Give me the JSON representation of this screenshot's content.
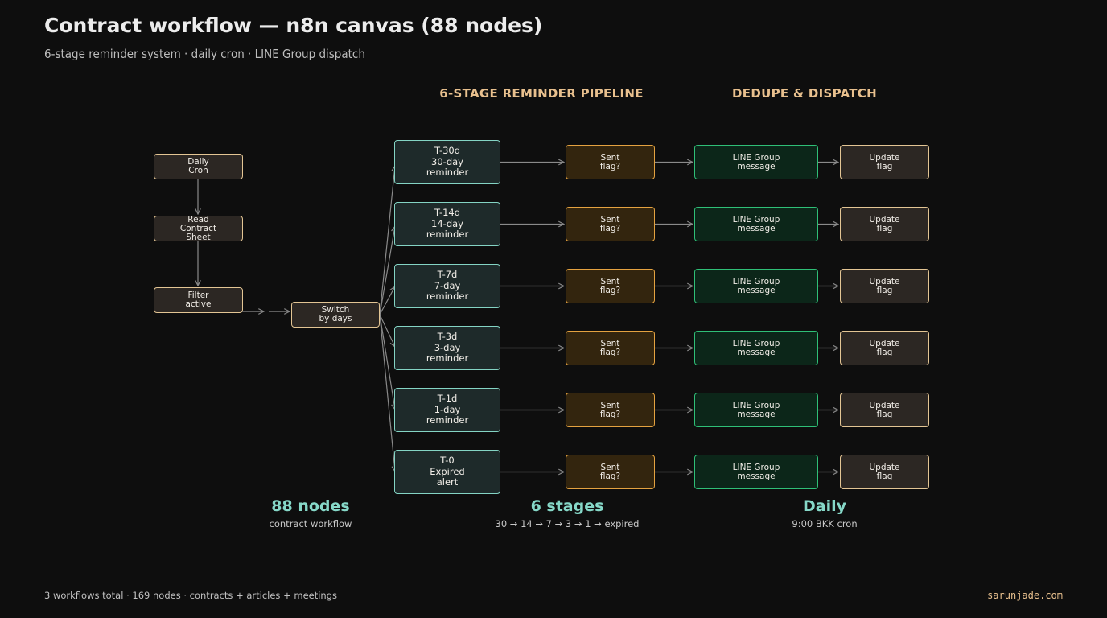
{
  "header": {
    "title": "Contract workflow — n8n canvas (88 nodes)",
    "subtitle": "6-stage reminder system · daily cron · LINE Group dispatch"
  },
  "sections": {
    "pipeline": "6-STAGE REMINDER PIPELINE",
    "dispatch": "DEDUPE & DISPATCH"
  },
  "trigger_nodes": [
    {
      "label": "Daily\nCron",
      "icon": "clock-icon"
    },
    {
      "label": "Read\nContract\nSheet",
      "icon": "sheet-icon"
    },
    {
      "label": "Filter\nactive",
      "icon": "filter-icon"
    }
  ],
  "switch_node": {
    "label": "Switch\nby days"
  },
  "stages": [
    {
      "reminder": "T-30d\n30-day\nreminder",
      "check": "Sent\nflag?",
      "message": "LINE Group\nmessage",
      "update": "Update\nflag"
    },
    {
      "reminder": "T-14d\n14-day\nreminder",
      "check": "Sent\nflag?",
      "message": "LINE Group\nmessage",
      "update": "Update\nflag"
    },
    {
      "reminder": "T-7d\n7-day\nreminder",
      "check": "Sent\nflag?",
      "message": "LINE Group\nmessage",
      "update": "Update\nflag"
    },
    {
      "reminder": "T-3d\n3-day\nreminder",
      "check": "Sent\nflag?",
      "message": "LINE Group\nmessage",
      "update": "Update\nflag"
    },
    {
      "reminder": "T-1d\n1-day\nreminder",
      "check": "Sent\nflag?",
      "message": "LINE Group\nmessage",
      "update": "Update\nflag"
    },
    {
      "reminder": "T-0\nExpired\nalert",
      "check": "Sent\nflag?",
      "message": "LINE Group\nmessage",
      "update": "Update\nflag"
    }
  ],
  "stats": [
    {
      "value": "88 nodes",
      "label": "contract workflow"
    },
    {
      "value": "6 stages",
      "label": "30 → 14 → 7 → 3 → 1 → expired"
    },
    {
      "value": "Daily",
      "label": "9:00 BKK cron"
    }
  ],
  "footer": {
    "left": "3 workflows total · 169 nodes · contracts + articles + meetings",
    "right": "sarunjade.com"
  },
  "colors": {
    "background": "#0e0e0e",
    "accent_tan": "#e3c594",
    "accent_teal": "#84d4c4",
    "accent_amber": "#e4a240",
    "accent_green": "#2fbf77",
    "section_heading": "#e8c08e",
    "connector": "#8a8a8a"
  }
}
